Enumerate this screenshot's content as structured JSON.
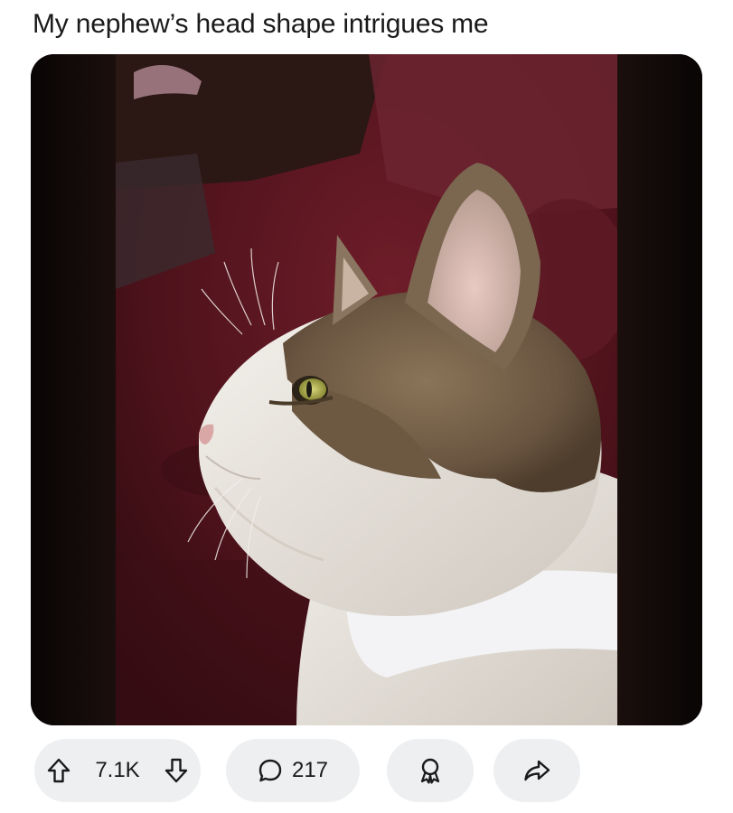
{
  "post": {
    "title": "My nephew’s head shape intrigues me",
    "image": {
      "alt": "",
      "subject": "cat in profile",
      "palette": {
        "background": "#0b0706",
        "sofa": "#5a1620",
        "fur_white": "#ece8e2",
        "fur_tabby": "#7a6650",
        "eye": "#b6b24a"
      }
    }
  },
  "actions": {
    "upvote_icon": "arrow-up-icon",
    "score": "7.1K",
    "downvote_icon": "arrow-down-icon",
    "comment_icon": "speech-bubble-icon",
    "comments": "217",
    "award_icon": "award-icon",
    "share_icon": "share-arrow-icon"
  },
  "colors": {
    "pill_background": "#edeff1",
    "text": "#1a1a1b"
  }
}
